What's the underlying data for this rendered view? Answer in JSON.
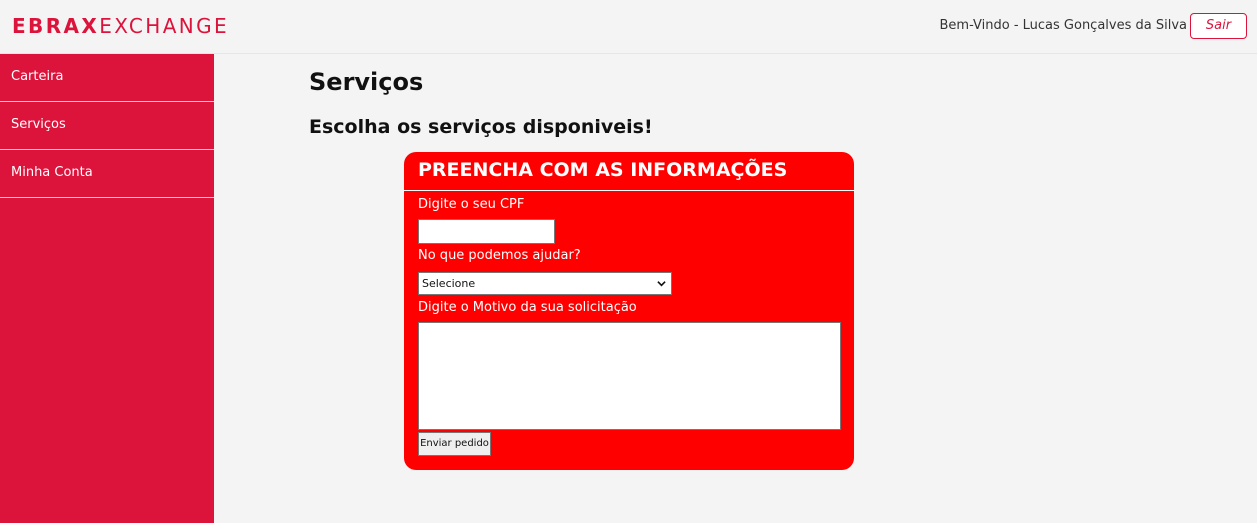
{
  "brand": {
    "logo_bold": "EBRAX",
    "logo_light": "EXCHANGE",
    "color": "#dc143c"
  },
  "header": {
    "welcome": "Bem-Vindo - Lucas Gonçalves da Silva",
    "logout_label": "Sair"
  },
  "sidebar": {
    "items": [
      {
        "label": "Carteira"
      },
      {
        "label": "Serviços"
      },
      {
        "label": "Minha Conta"
      }
    ]
  },
  "main": {
    "title": "Serviços",
    "subtitle": "Escolha os serviços disponiveis!"
  },
  "form": {
    "header": "PREENCHA COM AS INFORMAÇÕES",
    "cpf_label": "Digite o seu CPF",
    "cpf_value": "",
    "help_label": "No que podemos ajudar?",
    "help_selected": "Selecione",
    "reason_label": "Digite o Motivo da sua solicitação",
    "reason_value": "",
    "submit_label": "Enviar pedido",
    "card_color": "#ff0000"
  }
}
